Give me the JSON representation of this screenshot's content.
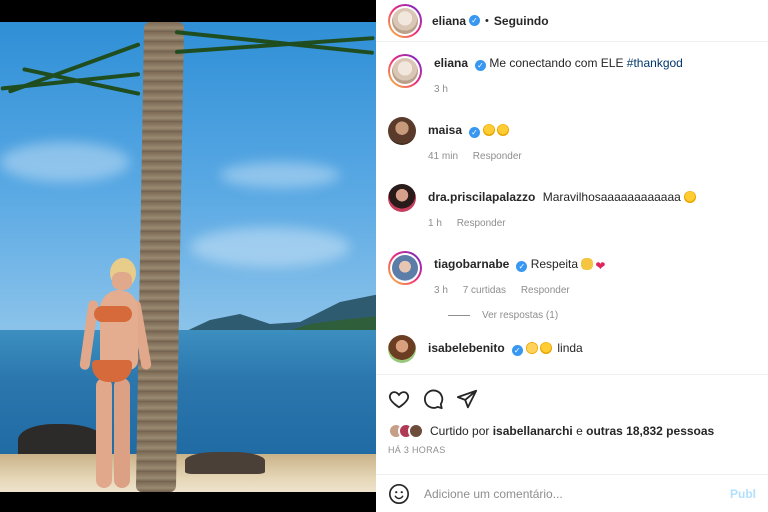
{
  "header": {
    "username": "eliana",
    "separator": "•",
    "follow_status": "Seguindo"
  },
  "caption": {
    "username": "eliana",
    "text": "Me conectando com ELE",
    "hashtag": "#thankgod",
    "time": "3 h"
  },
  "comments": [
    {
      "username": "maisa",
      "verified": true,
      "text": "",
      "emojis": [
        "star-struck",
        "star-struck"
      ],
      "time": "41 min",
      "reply_label": "Responder"
    },
    {
      "username": "dra.priscilapalazzo",
      "verified": false,
      "text": "Maravilhosaaaaaaaaaaaa",
      "emojis": [
        "star-struck"
      ],
      "time": "1 h",
      "reply_label": "Responder"
    },
    {
      "username": "tiagobarnabe",
      "verified": true,
      "text": "Respeita",
      "emojis": [
        "clapping-hands",
        "red-heart"
      ],
      "time": "3 h",
      "likes": "7 curtidas",
      "reply_label": "Responder",
      "view_replies": "Ver respostas (1)"
    },
    {
      "username": "isabelebenito",
      "verified": true,
      "text": "linda",
      "emojis": [
        "crying-face",
        "star-struck"
      ]
    }
  ],
  "actions": {
    "icons": [
      "heart-icon",
      "comment-icon",
      "share-icon"
    ]
  },
  "likes": {
    "prefix": "Curtido por",
    "user": "isabellanarchi",
    "connector": "e",
    "others": "outras 18,832 pessoas"
  },
  "post_time": "HÁ 3 HORAS",
  "add_comment": {
    "placeholder": "Adicione um comentário...",
    "post_label": "Publ"
  },
  "colors": {
    "verified": "#3897f0",
    "link": "#00376b",
    "muted": "#8e8e8e",
    "post_button": "#b2dffc"
  }
}
